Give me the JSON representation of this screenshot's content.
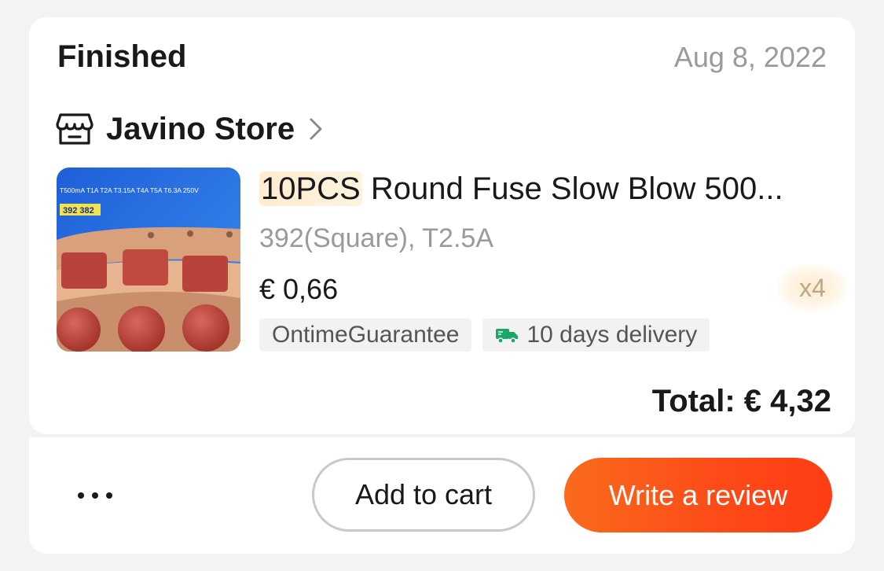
{
  "order": {
    "status": "Finished",
    "date": "Aug 8, 2022"
  },
  "store": {
    "name": "Javino Store",
    "icon": "store-icon"
  },
  "product": {
    "title_highlight": "10PCS",
    "title_rest": " Round Fuse Slow Blow 500...",
    "variant": "392(Square), T2.5A",
    "price": "€ 0,66",
    "quantity": "x4",
    "image": {
      "banner_text": "T500mA T1A T2A T3.15A T4A T5A T6.3A 250V",
      "model_label": "392 382"
    },
    "tags": [
      "OntimeGuarantee",
      "10 days delivery"
    ]
  },
  "total": "Total: € 4,32",
  "actions": {
    "more_icon": "more-dots-icon",
    "add_to_cart": "Add to cart",
    "write_review": "Write a review"
  },
  "colors": {
    "accent": "#fd4a18",
    "delivery_icon": "#1aa86a",
    "muted_text": "#9a9a9a"
  }
}
